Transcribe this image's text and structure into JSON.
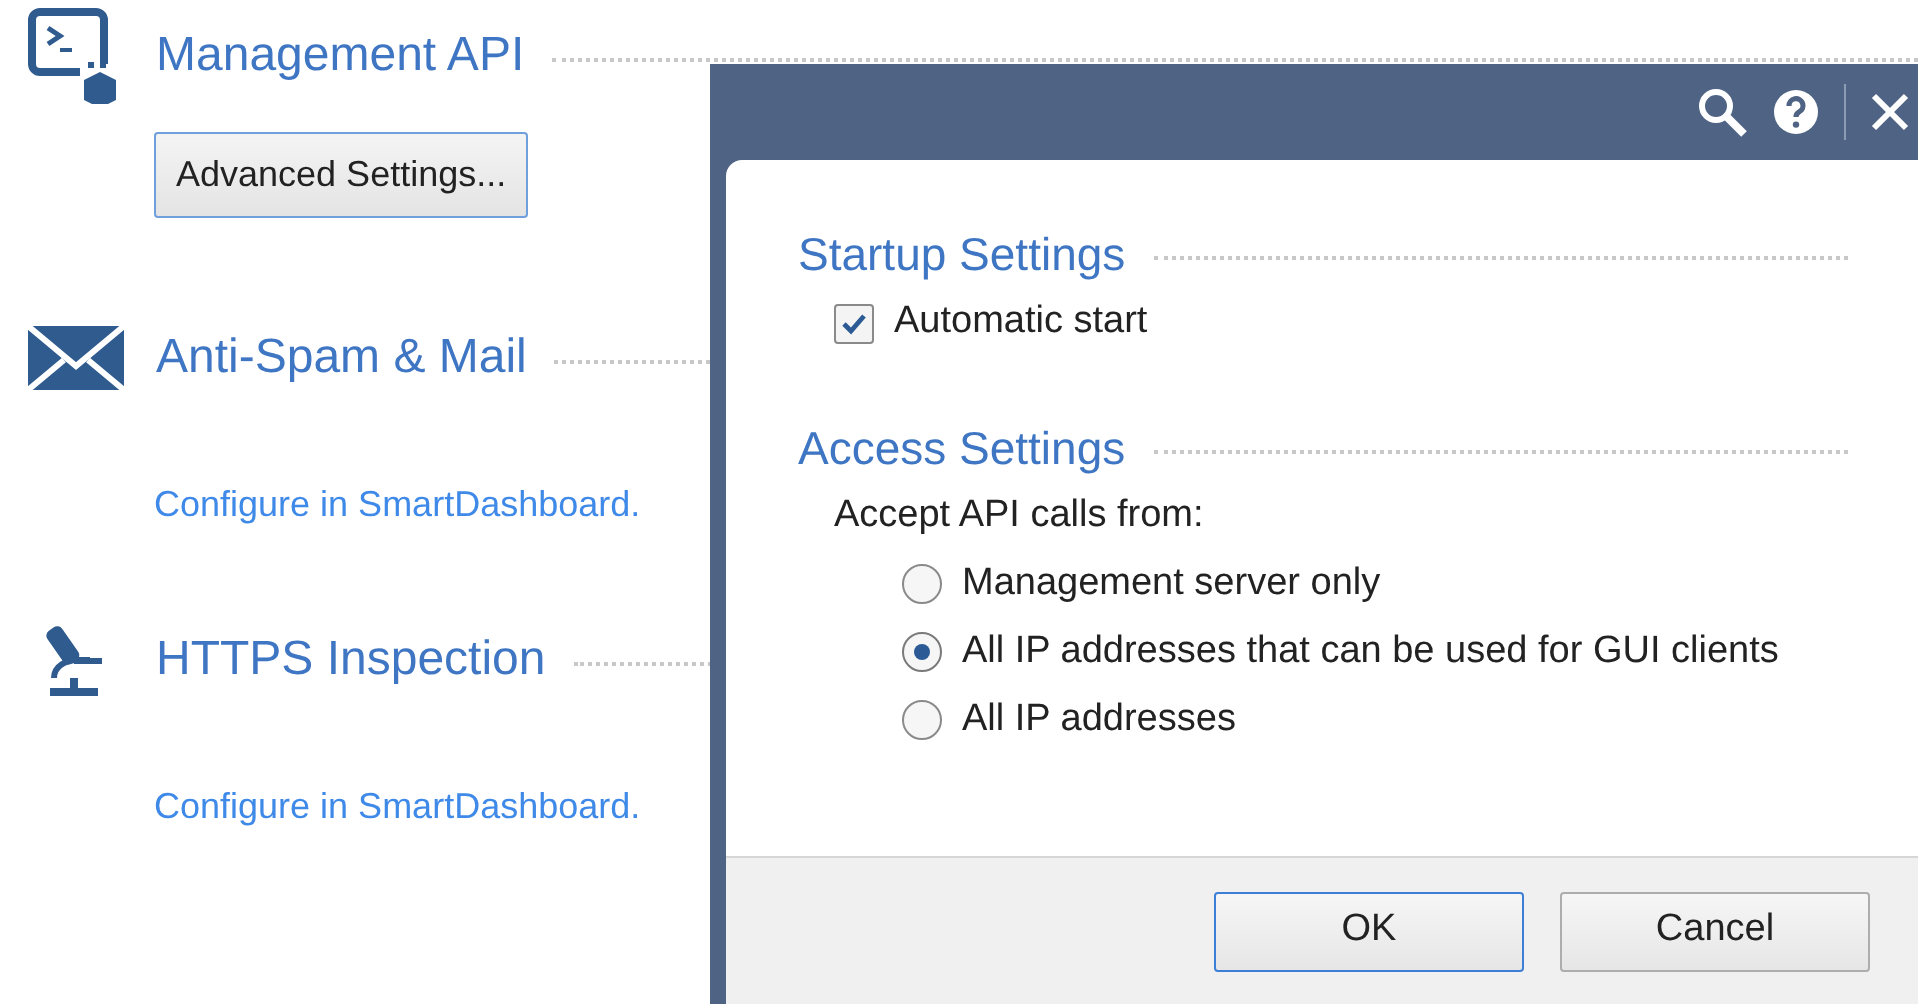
{
  "sections": [
    {
      "kind": "api",
      "title": "Management API",
      "button": "Advanced Settings..."
    },
    {
      "kind": "mail",
      "title": "Anti-Spam & Mail",
      "link": "Configure in SmartDashboard."
    },
    {
      "kind": "scope",
      "title": "HTTPS Inspection",
      "link": "Configure in SmartDashboard."
    }
  ],
  "dialog": {
    "groups": [
      {
        "title": "Startup Settings",
        "items": [
          {
            "kind": "checkbox",
            "label": "Automatic start",
            "checked": true
          }
        ]
      },
      {
        "title": "Access Settings",
        "items": [
          {
            "kind": "label",
            "label": "Accept API calls from:"
          },
          {
            "kind": "radio",
            "label": "Management server only",
            "selected": false
          },
          {
            "kind": "radio",
            "label": "All IP addresses that can be used for GUI clients",
            "selected": true
          },
          {
            "kind": "radio",
            "label": "All IP addresses",
            "selected": false
          }
        ]
      }
    ],
    "buttons": [
      {
        "label": "OK",
        "default": true
      },
      {
        "label": "Cancel",
        "default": false
      }
    ]
  }
}
